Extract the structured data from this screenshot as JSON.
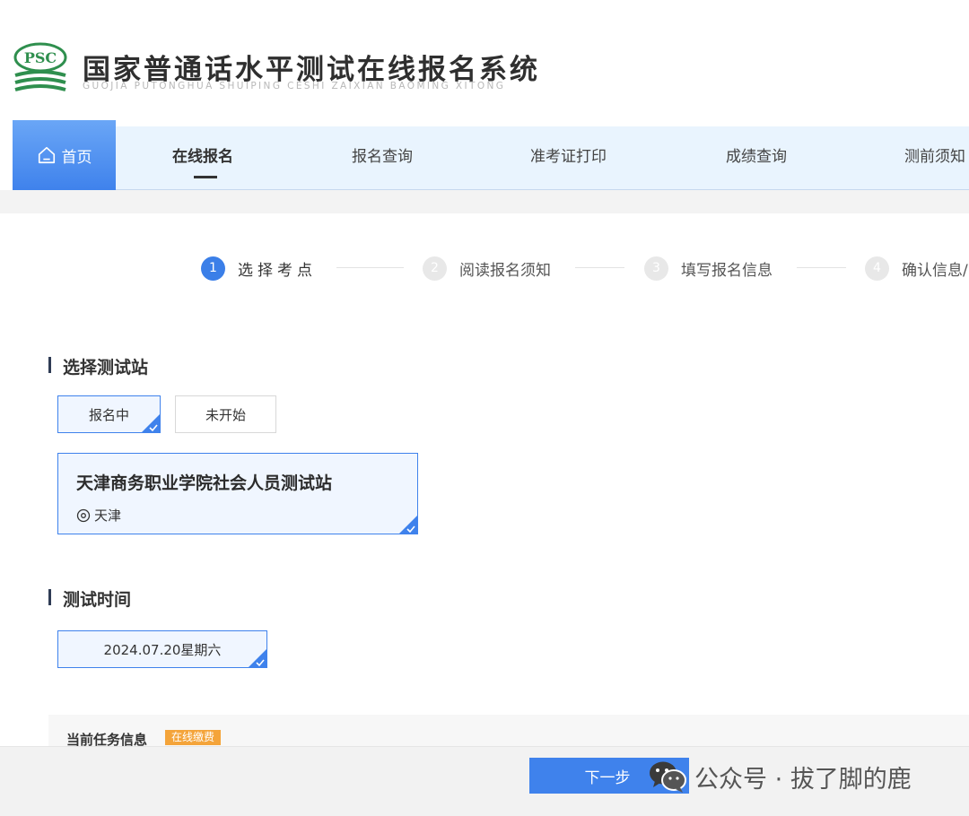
{
  "header": {
    "title": "国家普通话水平测试在线报名系统",
    "subtitle": "GUOJIA PUTONGHUA SHUIPING CESHI ZAIXIAN BAOMING XITONG",
    "logo_text": "PSC"
  },
  "nav": {
    "home": "首页",
    "items": [
      "在线报名",
      "报名查询",
      "准考证打印",
      "成绩查询",
      "测前须知"
    ],
    "active_index": 0
  },
  "steps": [
    {
      "num": "1",
      "label": "选择考点"
    },
    {
      "num": "2",
      "label": "阅读报名须知"
    },
    {
      "num": "3",
      "label": "填写报名信息"
    },
    {
      "num": "4",
      "label": "确认信息/"
    }
  ],
  "station_section": {
    "title": "选择测试站",
    "filters": [
      {
        "label": "报名中",
        "selected": true
      },
      {
        "label": "未开始",
        "selected": false
      }
    ],
    "stations": [
      {
        "name": "天津商务职业学院社会人员测试站",
        "location": "天津",
        "selected": true
      }
    ]
  },
  "time_section": {
    "title": "测试时间",
    "options": [
      {
        "label": "2024.07.20星期六",
        "selected": true
      }
    ]
  },
  "task": {
    "title": "当前任务信息",
    "badge": "在线缴费"
  },
  "actions": {
    "next_label": "下一步"
  },
  "watermark": {
    "text": "公众号 · 拔了脚的鹿"
  },
  "colors": {
    "accent": "#3f82ec",
    "nav_bg": "#e9f4fe",
    "badge": "#f4a43a",
    "logo_green": "#2f8f4e"
  }
}
